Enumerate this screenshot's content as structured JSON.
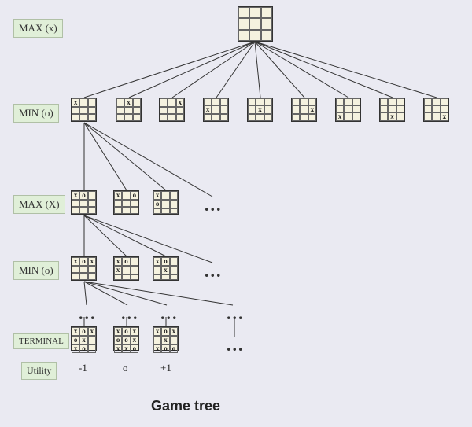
{
  "labels": {
    "max1": "MAX (x)",
    "min1": "MIN (o)",
    "max2": "MAX (X)",
    "min2": "MIN (o)",
    "terminal": "TERMINAL",
    "utility": "Utility"
  },
  "boards": {
    "root": [
      "",
      "",
      "",
      "",
      "",
      "",
      "",
      "",
      ""
    ],
    "r1": [
      [
        "x",
        "",
        "",
        "",
        "",
        "",
        "",
        "",
        ""
      ],
      [
        "",
        "x",
        "",
        "",
        "",
        "",
        "",
        "",
        ""
      ],
      [
        "",
        "",
        "x",
        "",
        "",
        "",
        "",
        "",
        ""
      ],
      [
        "",
        "",
        "",
        "x",
        "",
        "",
        "",
        "",
        ""
      ],
      [
        "",
        "",
        "",
        "",
        "x",
        "",
        "",
        "",
        ""
      ],
      [
        "",
        "",
        "",
        "",
        "",
        "x",
        "",
        "",
        ""
      ],
      [
        "",
        "",
        "",
        "",
        "",
        "",
        "x",
        "",
        ""
      ],
      [
        "",
        "",
        "",
        "",
        "",
        "",
        "",
        "x",
        ""
      ],
      [
        "",
        "",
        "",
        "",
        "",
        "",
        "",
        "",
        "x"
      ]
    ],
    "r2": [
      [
        "x",
        "o",
        "",
        "",
        "",
        "",
        "",
        "",
        ""
      ],
      [
        "x",
        "",
        "o",
        "",
        "",
        "",
        "",
        "",
        ""
      ],
      [
        "x",
        "",
        "",
        "o",
        "",
        "",
        "",
        "",
        ""
      ]
    ],
    "r3": [
      [
        "x",
        "o",
        "x",
        "",
        "",
        "",
        "",
        "",
        ""
      ],
      [
        "x",
        "o",
        "",
        "x",
        "",
        "",
        "",
        "",
        ""
      ],
      [
        "x",
        "o",
        "",
        "",
        "x",
        "",
        "",
        "",
        ""
      ]
    ],
    "r4": [
      [
        "x",
        "o",
        "x",
        "o",
        "x",
        "",
        "x",
        "o",
        ""
      ],
      [
        "x",
        "o",
        "x",
        "o",
        "o",
        "x",
        "x",
        "x",
        "o"
      ],
      [
        "x",
        "o",
        "x",
        "",
        "x",
        "",
        "x",
        "o",
        "o"
      ]
    ]
  },
  "utilities": [
    "-1",
    "o",
    "+1"
  ],
  "title": "Game tree",
  "ellipsis": "..."
}
